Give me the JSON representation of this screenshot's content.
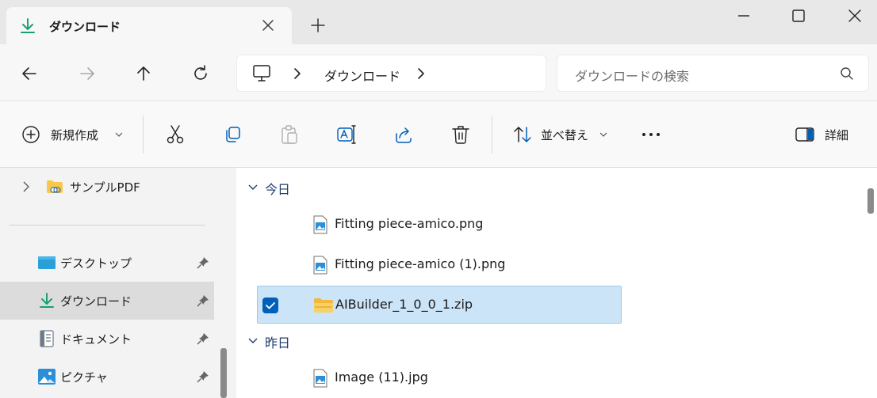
{
  "window": {
    "tab_title": "ダウンロード",
    "tab_icon": "download-icon",
    "controls": [
      "minimize-icon",
      "maximize-icon",
      "close-icon"
    ]
  },
  "address_bar": {
    "location_icon": "this-pc-icon",
    "path": [
      "ダウンロード"
    ]
  },
  "search": {
    "placeholder": "ダウンロードの検索",
    "icon": "search-icon"
  },
  "toolbar": {
    "new_label": "新規作成",
    "sort_label": "並べ替え",
    "details_label": "詳細",
    "icons": [
      "cut-icon",
      "copy-icon",
      "paste-icon",
      "rename-icon",
      "share-icon",
      "delete-icon",
      "sort-icon",
      "more-icon",
      "details-pane-icon"
    ]
  },
  "sidebar": {
    "items": [
      {
        "label": "サンプルPDF",
        "icon": "linked-folder-icon",
        "pinned": false,
        "selected": false
      },
      {
        "label": "デスクトップ",
        "icon": "desktop-icon",
        "pinned": true,
        "selected": false
      },
      {
        "label": "ダウンロード",
        "icon": "download-icon",
        "pinned": true,
        "selected": true
      },
      {
        "label": "ドキュメント",
        "icon": "document-icon",
        "pinned": true,
        "selected": false
      },
      {
        "label": "ピクチャ",
        "icon": "pictures-icon",
        "pinned": true,
        "selected": false
      }
    ]
  },
  "files": {
    "groups": [
      {
        "label": "今日",
        "items": [
          {
            "name": "Fitting piece-amico.png",
            "icon": "image-file-icon",
            "selected": false
          },
          {
            "name": "Fitting piece-amico (1).png",
            "icon": "image-file-icon",
            "selected": false
          },
          {
            "name": "AIBuilder_1_0_0_1.zip",
            "icon": "zip-folder-icon",
            "selected": true
          }
        ]
      },
      {
        "label": "昨日",
        "items": [
          {
            "name": "Image (11).jpg",
            "icon": "image-file-icon",
            "selected": false
          }
        ]
      }
    ]
  },
  "colors": {
    "accent": "#005fb8",
    "selection": "#cce4f7",
    "download_green": "#1aa06d",
    "group_header": "#1e3c70"
  }
}
